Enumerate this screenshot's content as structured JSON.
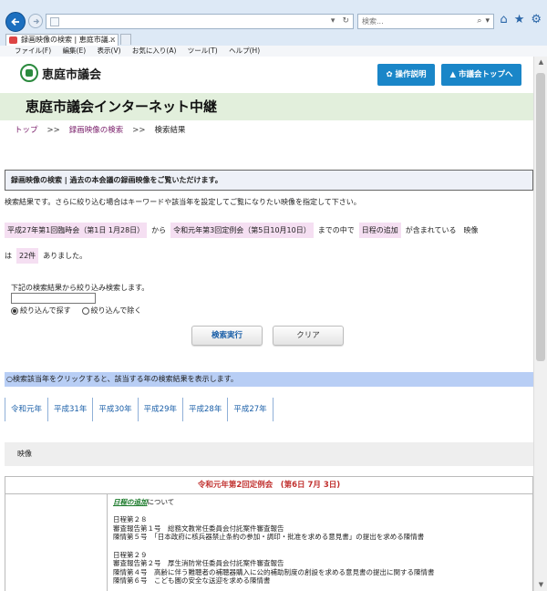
{
  "browser": {
    "tab_title": "録画映像の検索 | 恵庭市議...",
    "search_placeholder": "検索...",
    "menu": [
      "ファイル(F)",
      "編集(E)",
      "表示(V)",
      "お気に入り(A)",
      "ツール(T)",
      "ヘルプ(H)"
    ]
  },
  "header": {
    "site_name": "恵庭市議会",
    "guide_button": "操作説明",
    "top_button": "市議会トップへ"
  },
  "page_title": "恵庭市議会インターネット中継",
  "breadcrumb": {
    "top": "トップ",
    "sep": ">>",
    "video_search": "録画映像の検索",
    "current": "検索結果"
  },
  "section_heading": "録画映像の検索 | 過去の本会議の録画映像をご覧いただけます。",
  "intro_text": "検索結果です。さらに絞り込む場合はキーワードや該当年を設定してご覧になりたい映像を指定して下さい。",
  "result": {
    "from_session": "平成27年第1回臨時会（第1日 1月28日）",
    "from_word": "から",
    "to_session": "令和元年第3回定例会（第5日10月10日）",
    "between_word": "までの中で",
    "keyword": "日程の追加",
    "contains_word": "が含まれている　映像",
    "ha": "は",
    "count": "22件",
    "tail": "ありました。"
  },
  "refine": {
    "note": "下記の検索結果から絞り込み検索します。",
    "input_value": "",
    "radio_include": "絞り込んで探す",
    "radio_exclude": "絞り込んで除く"
  },
  "buttons": {
    "execute": "検索実行",
    "clear": "クリア"
  },
  "year_notice": "○検索該当年をクリックすると、該当する年の検索結果を表示します。",
  "years": [
    "令和元年",
    "平成31年",
    "平成30年",
    "平成29年",
    "平成28年",
    "平成27年"
  ],
  "video_label": "映像",
  "record": {
    "session": "令和元年第2回定例会　(第6日 7月 3日)",
    "topic_link": "日程の追加",
    "topic_suffix": "について",
    "lines": [
      "",
      "日程第２８",
      "審査報告第１号　総務文教常任委員会付託案件審査報告",
      "陳情第５号　「日本政府に核兵器禁止条約の参加・調印・批准を求める意見書」の提出を求める陳情書",
      "",
      "日程第２９",
      "審査報告第２号　厚生消防常任委員会付託案件審査報告",
      "陳情第４号　高齢に伴う難聴者の補聴器購入に公的補助制度の創設を求める意見書の提出に関する陳情書",
      "陳情第６号　こども園の安全な送迎を求める陳情書"
    ]
  },
  "colors": {
    "title_band": "#e2efdc",
    "header_button": "#1a86c8",
    "highlight": "#f5dff2",
    "notice_bar": "#b8cef5",
    "session_title": "#c0302e"
  }
}
